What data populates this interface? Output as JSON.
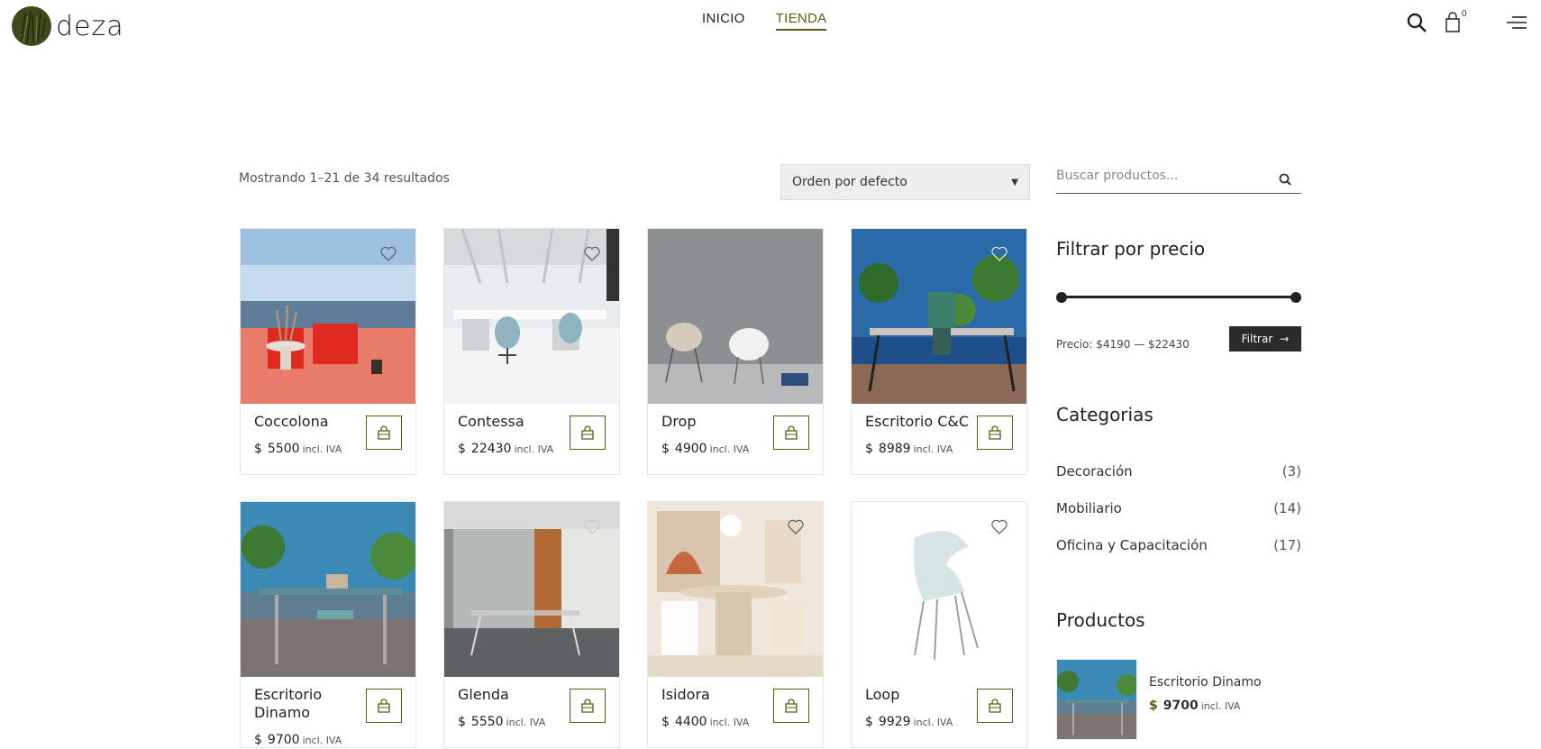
{
  "brand": {
    "name": "deza"
  },
  "nav": {
    "items": [
      {
        "label": "INICIO"
      },
      {
        "label": "TIENDA"
      }
    ]
  },
  "header": {
    "cart_count": "0"
  },
  "shop": {
    "result_count": "Mostrando 1–21 de 34 resultados",
    "sort": {
      "selected": "Orden por defecto"
    },
    "currency": "$",
    "tax_label": "incl. IVA",
    "products": [
      {
        "name": "Coccolona",
        "price": "5500"
      },
      {
        "name": "Contessa",
        "price": "22430"
      },
      {
        "name": "Drop",
        "price": "4900"
      },
      {
        "name": "Escritorio C&C",
        "price": "8989"
      },
      {
        "name": "Escritorio Dinamo",
        "price": "9700"
      },
      {
        "name": "Glenda",
        "price": "5550"
      },
      {
        "name": "Isidora",
        "price": "4400"
      },
      {
        "name": "Loop",
        "price": "9929"
      }
    ]
  },
  "sidebar": {
    "search_placeholder": "Buscar productos...",
    "price_filter": {
      "title": "Filtrar por precio",
      "range_label": "Precio: $4190 — $22430",
      "button_label": "Filtrar",
      "min_fraction": 0.0,
      "max_fraction": 1.0
    },
    "categories": {
      "title": "Categorias",
      "items": [
        {
          "label": "Decoración",
          "count": "(3)"
        },
        {
          "label": "Mobiliario",
          "count": "(14)"
        },
        {
          "label": "Oficina y Capacitación",
          "count": "(17)"
        }
      ]
    },
    "products": {
      "title": "Productos",
      "items": [
        {
          "name": "Escritorio Dinamo",
          "currency": "$",
          "price": "9700",
          "tax": "incl. IVA"
        }
      ]
    }
  },
  "colors": {
    "accent": "#5d5a16",
    "dark": "#2b2b2b"
  }
}
